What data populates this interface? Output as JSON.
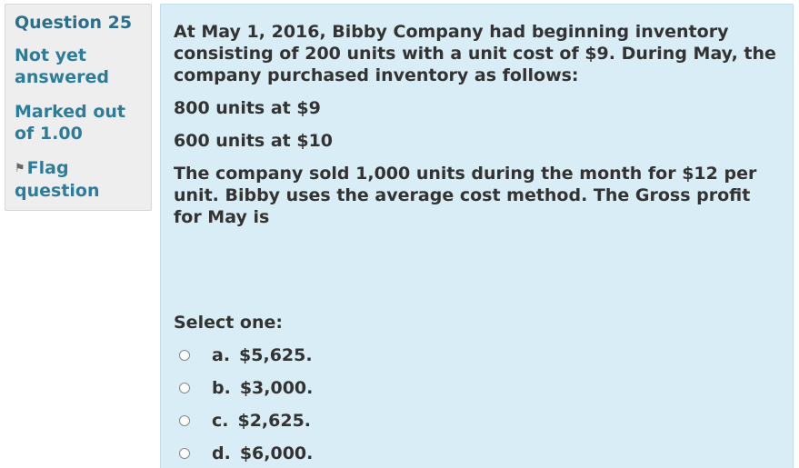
{
  "info": {
    "question_number": "Question 25",
    "state": "Not yet answered",
    "grade": "Marked out of 1.00",
    "flag_icon": "flag-icon",
    "flag_label": "Flag question"
  },
  "question": {
    "paragraphs": [
      "At May 1, 2016, Bibby Company had beginning inventory consisting of 200 units with a unit cost of $9.  During May, the company purchased inventory as follows:",
      "800 units at $9",
      "600 units at $10",
      "The company sold 1,000 units during the month for $12 per unit. Bibby uses the average cost method. The Gross profit for May is"
    ],
    "prompt": "Select one:",
    "answers": [
      {
        "letter": "a.",
        "text": "$5,625.",
        "selected": false
      },
      {
        "letter": "b.",
        "text": "$3,000.",
        "selected": false
      },
      {
        "letter": "c.",
        "text": "$2,625.",
        "selected": false
      },
      {
        "letter": "d.",
        "text": "$6,000.",
        "selected": false
      }
    ]
  },
  "colors": {
    "info_text": "#2d7d9a",
    "content_background": "#d9edf7",
    "info_background": "#eeeeee"
  }
}
